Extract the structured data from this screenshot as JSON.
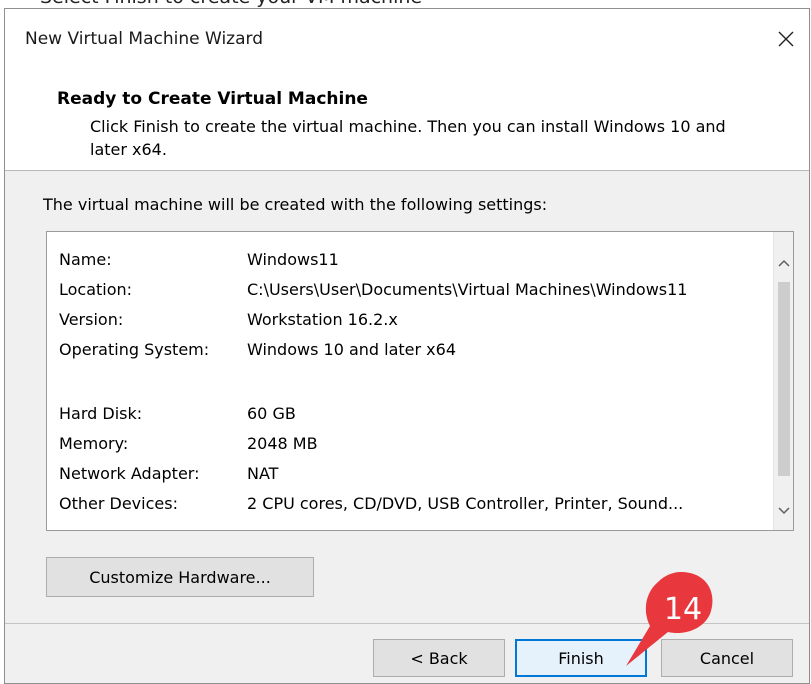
{
  "page_caption": "Select Finish to create your VM machine",
  "window": {
    "title": "New Virtual Machine Wizard"
  },
  "header": {
    "title": "Ready to Create Virtual Machine",
    "description": "Click Finish to create the virtual machine. Then you can install Windows 10 and later x64."
  },
  "intro_text": "The virtual machine will be created with the following settings:",
  "settings": [
    {
      "label": "Name:",
      "value": "Windows11"
    },
    {
      "label": "Location:",
      "value": "C:\\Users\\User\\Documents\\Virtual Machines\\Windows11"
    },
    {
      "label": "Version:",
      "value": "Workstation 16.2.x"
    },
    {
      "label": "Operating System:",
      "value": "Windows 10 and later x64"
    },
    {
      "label": "Hard Disk:",
      "value": "60 GB"
    },
    {
      "label": "Memory:",
      "value": "2048 MB"
    },
    {
      "label": "Network Adapter:",
      "value": "NAT"
    },
    {
      "label": "Other Devices:",
      "value": "2 CPU cores, CD/DVD, USB Controller, Printer, Sound..."
    }
  ],
  "buttons": {
    "customize": "Customize Hardware...",
    "back": "< Back",
    "finish": "Finish",
    "cancel": "Cancel"
  },
  "step_marker": {
    "number": "14",
    "color": "#e8383d"
  },
  "colors": {
    "accent": "#0078d7",
    "window_bg": "#f0f0f0"
  }
}
